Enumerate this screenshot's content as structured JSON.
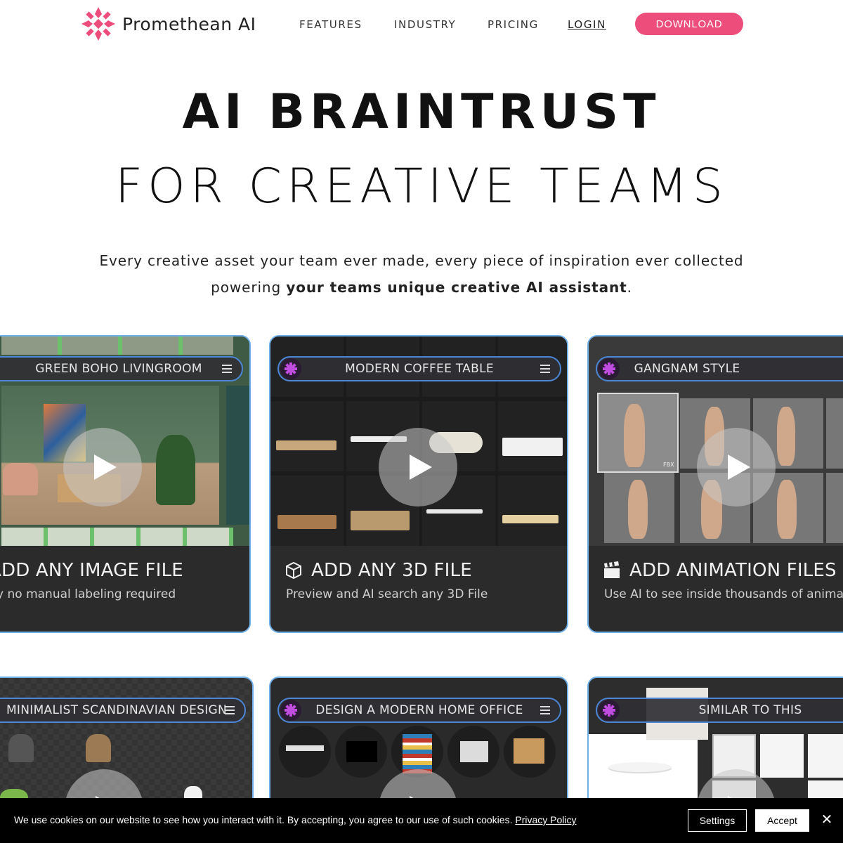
{
  "brand": {
    "name": "Promethean AI",
    "accent": "#ec4d7a"
  },
  "nav": {
    "features": "FEATURES",
    "industry": "INDUSTRY",
    "pricing": "PRICING",
    "login": "LOGIN",
    "download": "DOWNLOAD"
  },
  "hero": {
    "title": "AI BRAINTRUST",
    "subtitle": "FOR CREATIVE TEAMS",
    "tagline_line1": "Every creative asset your team ever made, every piece of inspiration ever collected",
    "tagline_line2_prefix": "powering ",
    "tagline_line2_bold": "your teams unique creative AI assistant",
    "tagline_line2_suffix": "."
  },
  "cards": [
    {
      "pill": "GREEN BOHO LIVINGROOM",
      "title": "ADD ANY IMAGE FILE",
      "desc": "Absolutely no manual labeling required",
      "icon": "image-icon"
    },
    {
      "pill": "MODERN COFFEE TABLE",
      "title": "ADD ANY 3D FILE",
      "desc": "Preview and AI search any 3D File",
      "icon": "cube-icon"
    },
    {
      "pill": "GANGNAM STYLE",
      "title": "ADD ANIMATION FILES",
      "desc": "Use AI to see inside thousands of animations",
      "icon": "clapperboard-icon"
    },
    {
      "pill": "MINIMALIST SCANDINAVIAN DESIGN"
    },
    {
      "pill": "DESIGN A MODERN HOME OFFICE"
    },
    {
      "pill": "SIMILAR TO THIS"
    }
  ],
  "file_badge": "FBX",
  "cookie": {
    "text": "We use cookies on our website to see how you interact with it. By accepting, you agree to our use of such cookies. ",
    "policy": "Privacy Policy",
    "settings": "Settings",
    "accept": "Accept",
    "close": "✕"
  }
}
